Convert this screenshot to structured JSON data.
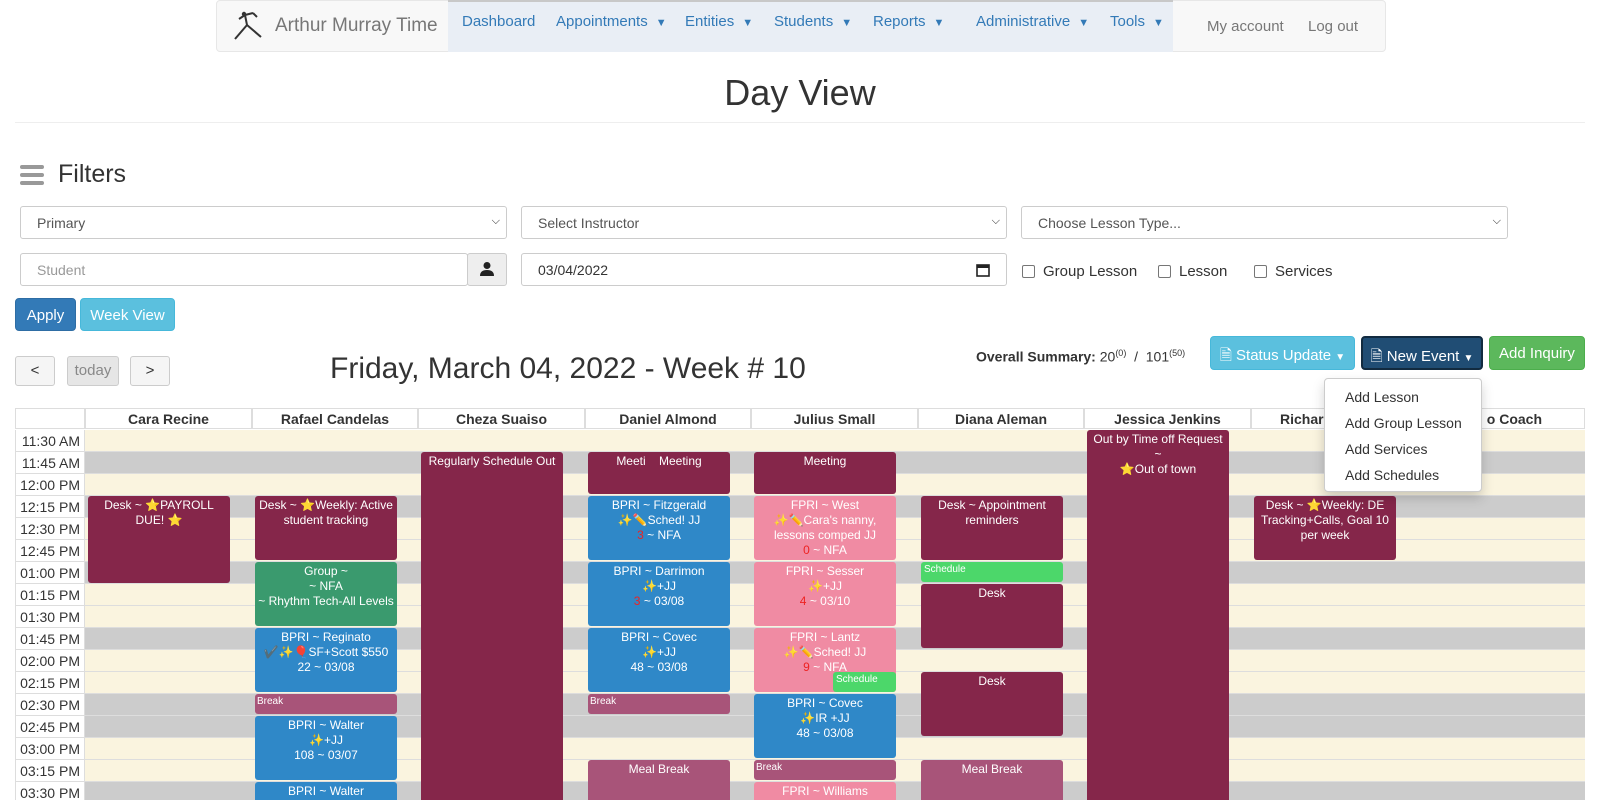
{
  "nav": {
    "brand": "Arthur Murray Time",
    "items": [
      {
        "label": "Dashboard",
        "dropdown": false
      },
      {
        "label": "Appointments",
        "dropdown": true
      },
      {
        "label": "Entities",
        "dropdown": true
      },
      {
        "label": "Students",
        "dropdown": true
      },
      {
        "label": "Reports",
        "dropdown": true
      },
      {
        "label": "Administrative",
        "dropdown": true
      },
      {
        "label": "Tools",
        "dropdown": true
      }
    ],
    "my_account": "My account",
    "logout": "Log out"
  },
  "page_title": "Day View",
  "filters": {
    "heading": "Filters",
    "location_select": "Primary",
    "instructor_select": "Select Instructor",
    "lesson_type_select": "Choose Lesson Type...",
    "student_placeholder": "Student",
    "date_value": "03/04/2022",
    "checkboxes": [
      {
        "label": "Group Lesson",
        "checked": false
      },
      {
        "label": "Lesson",
        "checked": false
      },
      {
        "label": "Services",
        "checked": false
      }
    ],
    "apply": "Apply",
    "week_view": "Week View"
  },
  "toolbar": {
    "prev": "<",
    "today": "today",
    "next": ">",
    "day_heading": "Friday, March 04, 2022 - Week # 10",
    "summary_label": "Overall Summary:",
    "summary_a": "20",
    "summary_a_sup": "(0)",
    "summary_sep": "/",
    "summary_b": "101",
    "summary_b_sup": "(50)",
    "status_update": "Status Update",
    "new_event": "New Event",
    "add_inquiry": "Add Inquiry"
  },
  "new_event_menu": [
    "Add Lesson",
    "Add Group Lesson",
    "Add Services",
    "Add Schedules"
  ],
  "colors": {
    "maroon": "#85264a",
    "blue": "#2f88c8",
    "pink": "#f08ba3",
    "green": "#3a9a6e",
    "break": "#a85479",
    "schedule": "#4cd76a",
    "apply_btn": "#337ab7",
    "info_btn": "#5bc0de",
    "new_event_btn": "#204d74",
    "success_btn": "#5cb85c"
  },
  "calendar": {
    "instructors": [
      "Cara Recine",
      "Rafael Candelas",
      "Cheza Suaiso",
      "Daniel Almond",
      "Julius Small",
      "Diana Aleman",
      "Jessica Jenkins",
      "Richar",
      "o Coach"
    ],
    "times": [
      "11:30 AM",
      "11:45 AM",
      "12:00 PM",
      "12:15 PM",
      "12:30 PM",
      "12:45 PM",
      "01:00 PM",
      "01:15 PM",
      "01:30 PM",
      "01:45 PM",
      "02:00 PM",
      "02:15 PM",
      "02:30 PM",
      "02:45 PM",
      "03:00 PM",
      "03:15 PM",
      "03:30 PM"
    ],
    "events": {
      "cara_desk": [
        "Desk ~ ⭐PAYROLL",
        "DUE! ⭐"
      ],
      "rafael_desk": [
        "Desk ~ ⭐Weekly: Active",
        "student tracking"
      ],
      "rafael_group": [
        "Group ~",
        "~ NFA",
        "~ Rhythm Tech-All Levels"
      ],
      "rafael_reginato": [
        "BPRI ~ Reginato",
        "✔️✨🎈SF+Scott $550",
        "22 ~ 03/08"
      ],
      "rafael_break": "Break",
      "rafael_walter1": [
        "BPRI ~ Walter",
        "✨+JJ",
        "108 ~ 03/07"
      ],
      "rafael_walter2": "BPRI ~ Walter",
      "cheza_out": "Regularly Schedule Out",
      "daniel_meeting": "Meeti    Meeting",
      "daniel_fitzgerald": [
        "BPRI ~ Fitzgerald",
        "✨✏️Sched! JJ",
        "3",
        " ~ NFA"
      ],
      "daniel_darrimon": [
        "BPRI ~ Darrimon",
        "✨+JJ",
        "3",
        " ~ 03/08"
      ],
      "daniel_covec": [
        "BPRI ~ Covec",
        "✨+JJ",
        "48 ~ 03/08"
      ],
      "daniel_break": "Break",
      "daniel_meal": "Meal Break",
      "julius_meeting": "Meeting",
      "julius_west": [
        "FPRI ~ West",
        "✨✏️Cara's nanny,",
        "lessons comped JJ",
        "0",
        " ~ NFA"
      ],
      "julius_sesser": [
        "FPRI ~ Sesser",
        "✨+JJ",
        "4",
        " ~ 03/10"
      ],
      "julius_lantz": [
        "FPRI ~ Lantz",
        "✨✏️Sched! JJ",
        "9",
        " ~ NFA"
      ],
      "julius_schedule": "Schedule",
      "julius_covec": [
        "BPRI ~ Covec",
        "✨IR +JJ",
        "48 ~ 03/08"
      ],
      "julius_break": "Break",
      "julius_williams": "FPRI ~ Williams",
      "diana_desk1": [
        "Desk ~ Appointment",
        "reminders"
      ],
      "diana_schedule": "Schedule",
      "diana_desk2": "Desk",
      "diana_desk3": "Desk",
      "diana_meal": "Meal Break",
      "jessica_out": [
        "Out by Time off Request ~",
        "⭐Out of town"
      ],
      "richard_desk": [
        "Desk ~ ⭐Weekly: DE",
        "Tracking+Calls, Goal 10",
        "per week"
      ]
    }
  }
}
